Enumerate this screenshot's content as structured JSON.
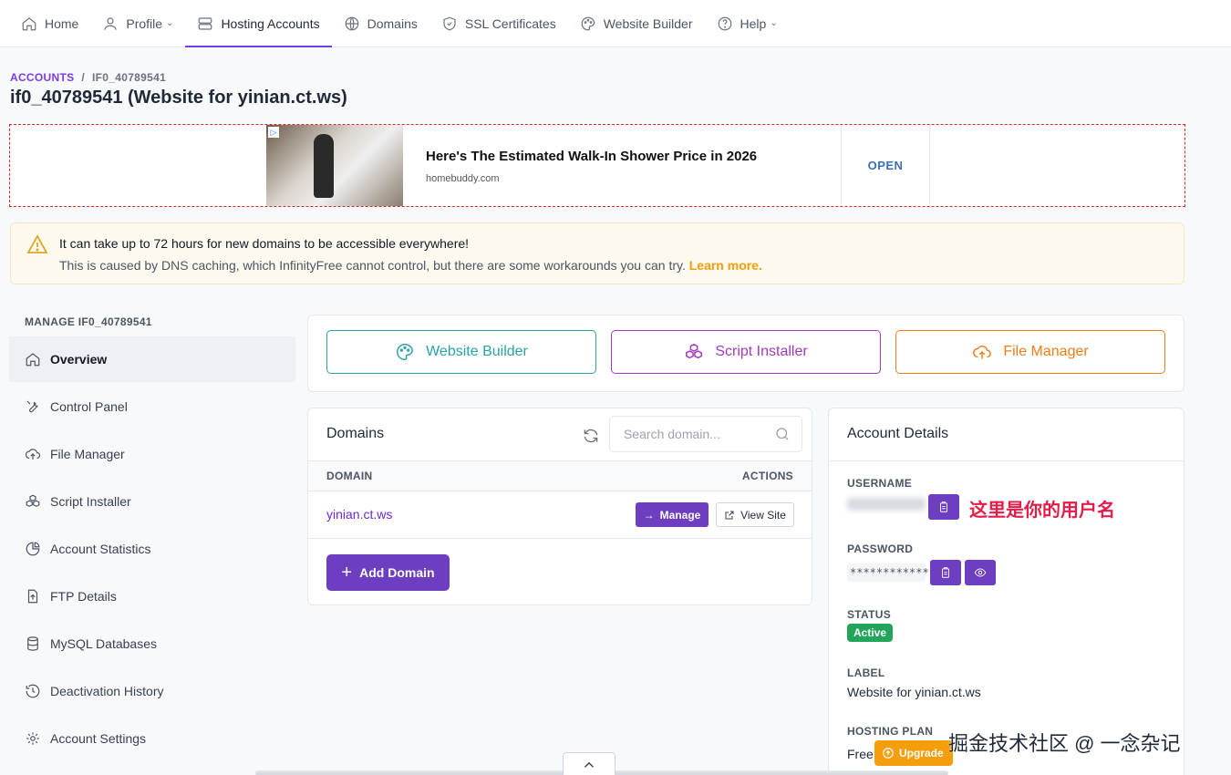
{
  "nav": {
    "items": [
      {
        "label": "Home",
        "icon": "home-icon"
      },
      {
        "label": "Profile",
        "icon": "user-icon",
        "caret": true
      },
      {
        "label": "Hosting Accounts",
        "icon": "server-icon",
        "active": true
      },
      {
        "label": "Domains",
        "icon": "globe-icon"
      },
      {
        "label": "SSL Certificates",
        "icon": "shield-icon"
      },
      {
        "label": "Website Builder",
        "icon": "palette-icon"
      },
      {
        "label": "Help",
        "icon": "help-icon",
        "caret": true
      }
    ]
  },
  "breadcrumb": {
    "root": "ACCOUNTS",
    "sep": "/",
    "current": "IF0_40789541"
  },
  "page_title": "if0_40789541 (Website for yinian.ct.ws)",
  "ad": {
    "headline": "Here's The Estimated Walk-In Shower Price in 2026",
    "domain": "homebuddy.com",
    "open_label": "OPEN"
  },
  "alert": {
    "title": "It can take up to 72 hours for new domains to be accessible everywhere!",
    "body": "This is caused by DNS caching, which InfinityFree cannot control, but there are some workarounds you can try.",
    "link": "Learn more."
  },
  "sidebar": {
    "heading": "MANAGE IF0_40789541",
    "items": [
      {
        "label": "Overview",
        "active": true
      },
      {
        "label": "Control Panel"
      },
      {
        "label": "File Manager"
      },
      {
        "label": "Script Installer"
      },
      {
        "label": "Account Statistics"
      },
      {
        "label": "FTP Details"
      },
      {
        "label": "MySQL Databases"
      },
      {
        "label": "Deactivation History"
      },
      {
        "label": "Account Settings"
      }
    ]
  },
  "quick_actions": {
    "website_builder": "Website Builder",
    "script_installer": "Script Installer",
    "file_manager": "File Manager"
  },
  "domains": {
    "title": "Domains",
    "search_placeholder": "Search domain...",
    "col_domain": "DOMAIN",
    "col_actions": "ACTIONS",
    "rows": [
      {
        "domain": "yinian.ct.ws"
      }
    ],
    "manage_label": "Manage",
    "view_label": "View Site",
    "add_label": "Add Domain"
  },
  "account": {
    "title": "Account Details",
    "username_label": "USERNAME",
    "username_annotation": "这里是你的用户名",
    "password_label": "PASSWORD",
    "password_mask": "************",
    "status_label": "STATUS",
    "status_value": "Active",
    "label_label": "LABEL",
    "label_value": "Website for yinian.ct.ws",
    "plan_label": "HOSTING PLAN",
    "plan_value": "Free",
    "upgrade_label": "Upgrade"
  },
  "watermark": "掘金技术社区 @ 一念杂记",
  "colors": {
    "accent": "#6d3fc0",
    "teal": "#2aa1a6",
    "purple": "#a13bbd",
    "orange": "#ee7d1a",
    "success": "#22a55a",
    "warning": "#f59e0b"
  }
}
